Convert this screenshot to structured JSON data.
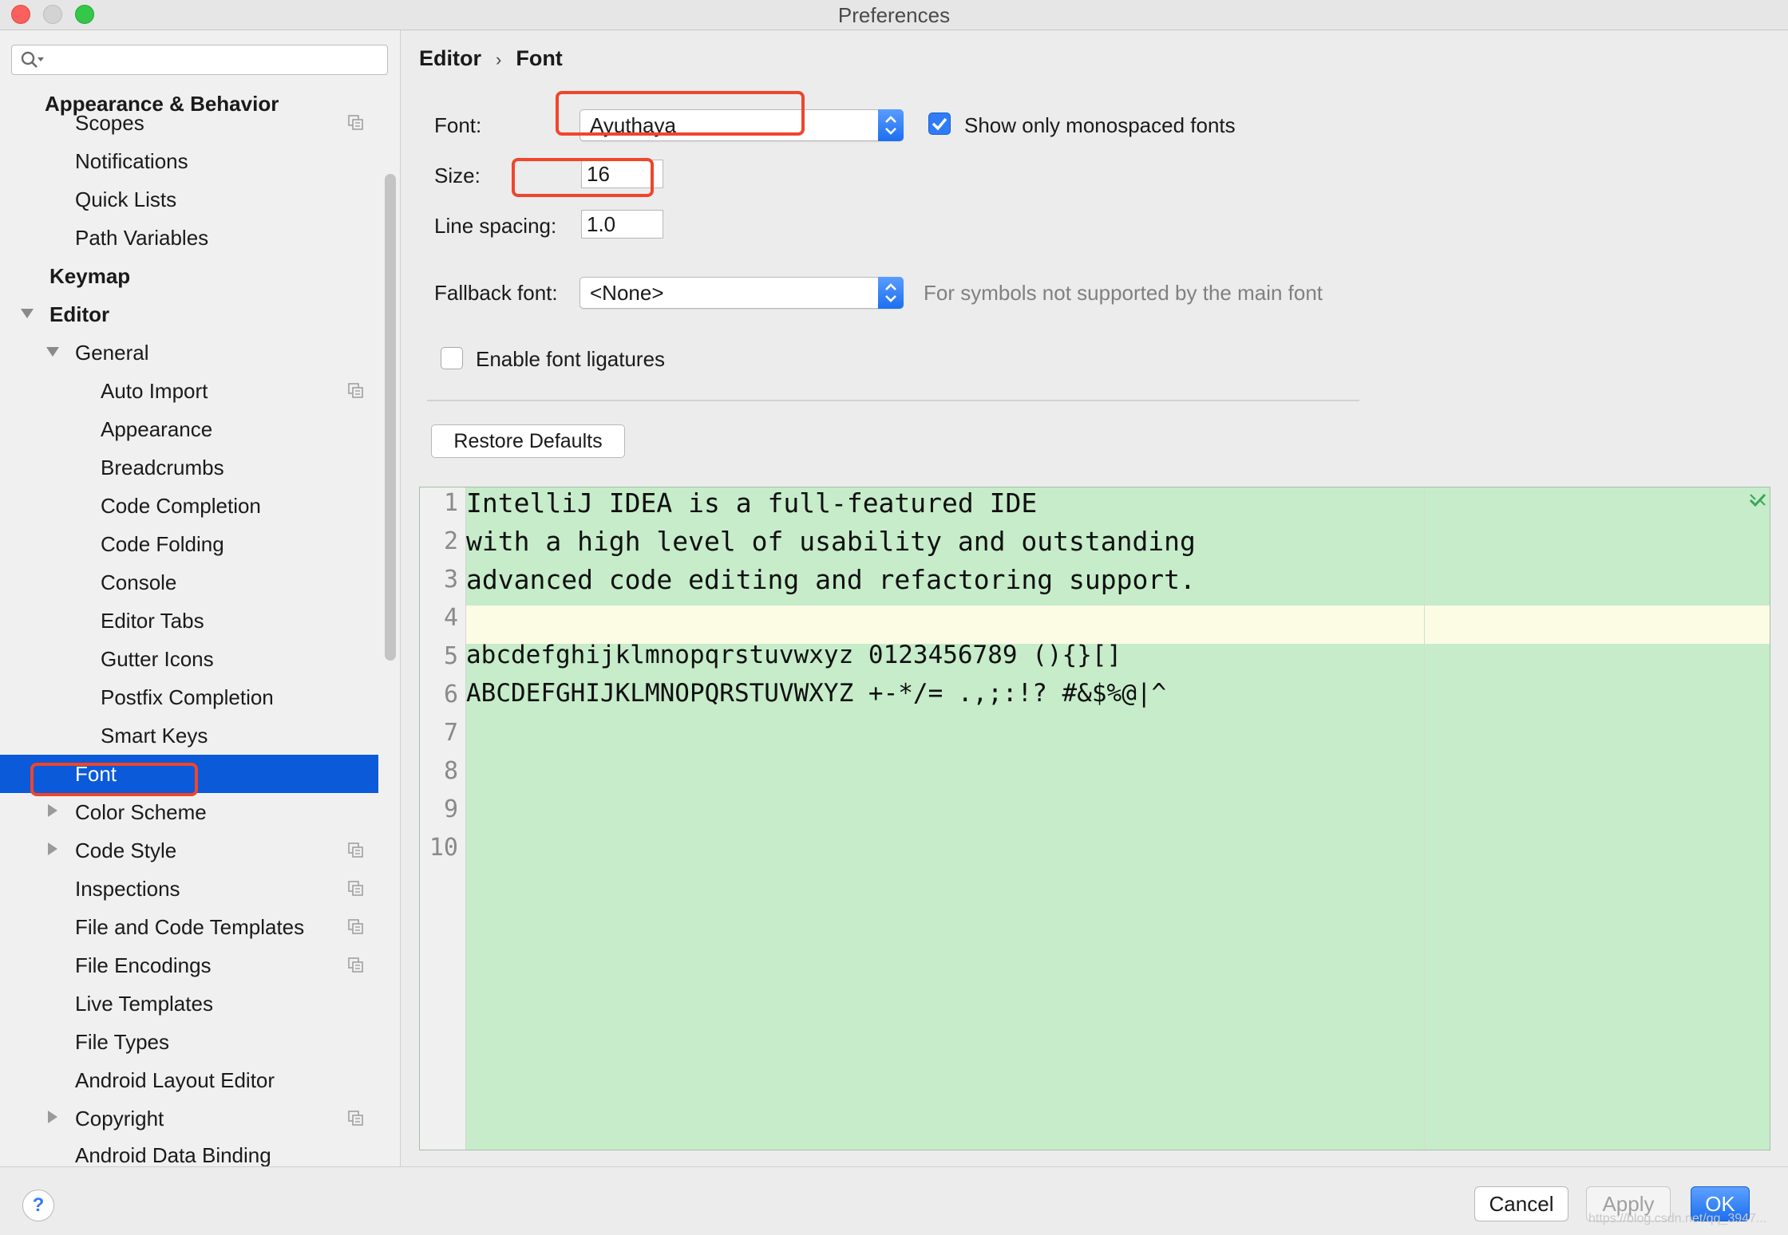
{
  "window": {
    "title": "Preferences"
  },
  "search": {
    "placeholder": ""
  },
  "sidebar": {
    "items": [
      {
        "label": "Appearance & Behavior",
        "bold": true
      },
      {
        "label": "Scopes",
        "shared": true
      },
      {
        "label": "Notifications"
      },
      {
        "label": "Quick Lists"
      },
      {
        "label": "Path Variables"
      },
      {
        "label": "Keymap",
        "bold": true
      },
      {
        "label": "Editor",
        "bold": true,
        "expanded": true
      },
      {
        "label": "General",
        "expanded": true
      },
      {
        "label": "Auto Import",
        "shared": true
      },
      {
        "label": "Appearance"
      },
      {
        "label": "Breadcrumbs"
      },
      {
        "label": "Code Completion"
      },
      {
        "label": "Code Folding"
      },
      {
        "label": "Console"
      },
      {
        "label": "Editor Tabs"
      },
      {
        "label": "Gutter Icons"
      },
      {
        "label": "Postfix Completion"
      },
      {
        "label": "Smart Keys"
      },
      {
        "label": "Font",
        "selected": true
      },
      {
        "label": "Color Scheme",
        "collapsed": true
      },
      {
        "label": "Code Style",
        "collapsed": true,
        "shared": true
      },
      {
        "label": "Inspections",
        "shared": true
      },
      {
        "label": "File and Code Templates",
        "shared": true
      },
      {
        "label": "File Encodings",
        "shared": true
      },
      {
        "label": "Live Templates"
      },
      {
        "label": "File Types"
      },
      {
        "label": "Android Layout Editor"
      },
      {
        "label": "Copyright",
        "collapsed": true,
        "shared": true
      },
      {
        "label": "Android Data Binding"
      }
    ]
  },
  "breadcrumb": {
    "parent": "Editor",
    "separator": "›",
    "current": "Font"
  },
  "form": {
    "font_label": "Font:",
    "font_value": "Ayuthaya",
    "monospaced_label": "Show only monospaced fonts",
    "monospaced_checked": true,
    "size_label": "Size:",
    "size_value": "16",
    "line_spacing_label": "Line spacing:",
    "line_spacing_value": "1.0",
    "fallback_label": "Fallback font:",
    "fallback_value": "<None>",
    "fallback_hint": "For symbols not supported by the main font",
    "ligatures_label": "Enable font ligatures",
    "ligatures_checked": false,
    "restore_label": "Restore Defaults"
  },
  "preview": {
    "line_numbers": [
      "1",
      "2",
      "3",
      "4",
      "5",
      "6",
      "7",
      "8",
      "9",
      "10"
    ],
    "lines": [
      "IntelliJ IDEA is a full-featured IDE",
      "with a high level of usability and outstanding",
      "advanced code editing and refactoring support.",
      "",
      "abcdefghijklmnopqrstuvwxyz 0123456789 (){}[]",
      "ABCDEFGHIJKLMNOPQRSTUVWXYZ +-*/= .,;:!? #&$%@|^"
    ]
  },
  "footer": {
    "help_label": "?",
    "cancel_label": "Cancel",
    "apply_label": "Apply",
    "ok_label": "OK",
    "watermark": "https://blog.csdn.net/qq_3947..."
  },
  "colors": {
    "selection": "#0b5ad9",
    "annotation": "#f0452c",
    "preview_bg": "#c6ecca",
    "caret_row": "#fcfbe4",
    "accent": "#2f7cf6"
  }
}
